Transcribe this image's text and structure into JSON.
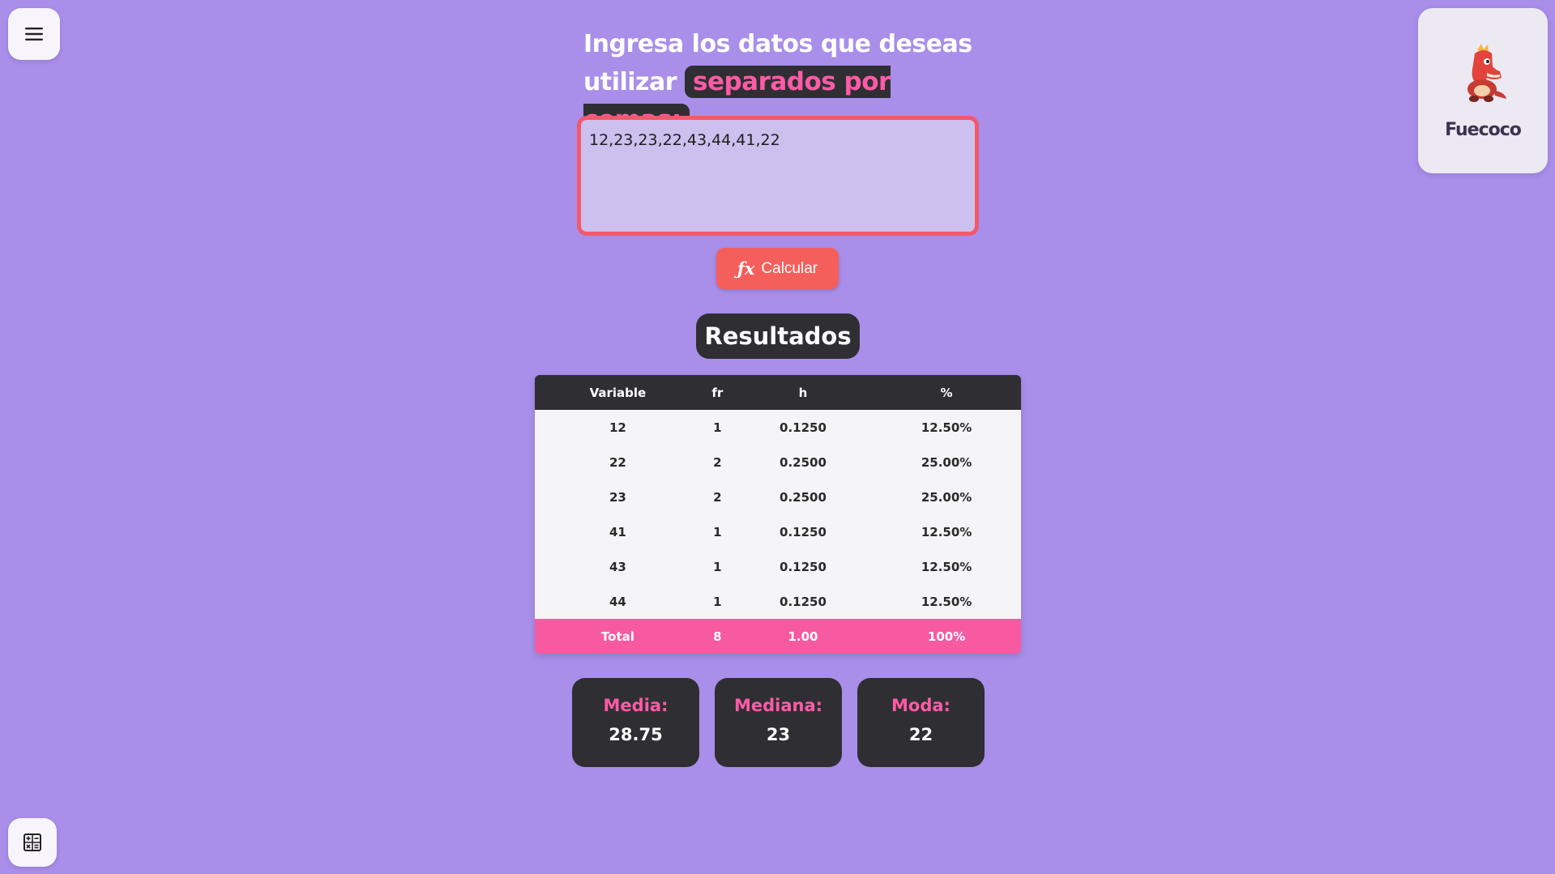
{
  "menu": {
    "icon": "hamburger-menu-icon"
  },
  "heading": {
    "line1": "Ingresa los datos que deseas",
    "line2_prefix": "utilizar",
    "highlight": "separados por comas:"
  },
  "input": {
    "value": "12,23,23,22,43,44,41,22"
  },
  "calculate_button": {
    "icon": "fx-icon",
    "icon_text": "ƒx",
    "label": "Calcular"
  },
  "results": {
    "title": "Resultados"
  },
  "table": {
    "headers": [
      "Variable",
      "fr",
      "h",
      "%"
    ],
    "rows": [
      [
        "12",
        "1",
        "0.1250",
        "12.50%"
      ],
      [
        "22",
        "2",
        "0.2500",
        "25.00%"
      ],
      [
        "23",
        "2",
        "0.2500",
        "25.00%"
      ],
      [
        "41",
        "1",
        "0.1250",
        "12.50%"
      ],
      [
        "43",
        "1",
        "0.1250",
        "12.50%"
      ],
      [
        "44",
        "1",
        "0.1250",
        "12.50%"
      ]
    ],
    "total": [
      "Total",
      "8",
      "1.00",
      "100%"
    ]
  },
  "stats": {
    "media": {
      "label": "Media:",
      "value": "28.75"
    },
    "mediana": {
      "label": "Mediana:",
      "value": "23"
    },
    "moda": {
      "label": "Moda:",
      "value": "22"
    }
  },
  "pokemon": {
    "name": "Fuecoco",
    "icon": "fuecoco-sprite"
  },
  "bottom_button": {
    "icon": "calculator-icon"
  },
  "colors": {
    "background": "#a98eea",
    "dark": "#2f2f33",
    "pink": "#f75aa0",
    "coral": "#f45f5b"
  }
}
